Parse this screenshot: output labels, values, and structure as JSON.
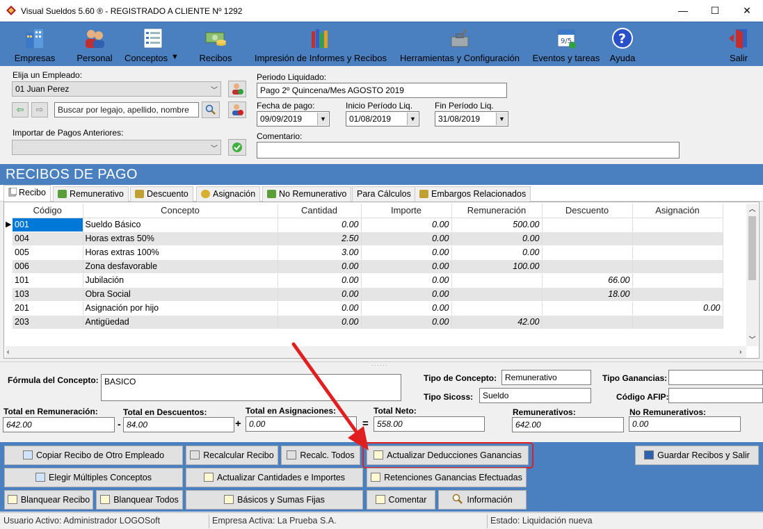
{
  "window": {
    "title": "Visual Sueldos 5.60 ®    - REGISTRADO A CLIENTE Nº 1292",
    "minimize": "—",
    "maximize": "☐",
    "close": "✕"
  },
  "toolbar": {
    "items": [
      {
        "label": "Empresas",
        "icon": "buildings-icon"
      },
      {
        "label": "Personal",
        "icon": "people-icon"
      },
      {
        "label": "Conceptos",
        "icon": "list-icon"
      },
      {
        "label": "Recibos",
        "icon": "money-icon"
      },
      {
        "label": "Impresión de Informes y Recibos",
        "icon": "books-icon"
      },
      {
        "label": "Herramientas y Configuración",
        "icon": "tools-icon"
      },
      {
        "label": "Eventos y tareas",
        "icon": "calendar-icon"
      },
      {
        "label": "Ayuda",
        "icon": "help-icon"
      },
      {
        "label": "Salir",
        "icon": "exit-door-icon"
      }
    ],
    "dropdown_arrow": "▼"
  },
  "form": {
    "employee_label": "Elija un Empleado:",
    "employee_value": "01 Juan Perez",
    "search_placeholder": "Buscar por legajo, apellido, nombre",
    "import_label": "Importar de Pagos Anteriores:",
    "import_value": "",
    "period_label": "Periodo Liquidado:",
    "period_value": "Pago 2º Quincena/Mes AGOSTO 2019",
    "pay_date_label": "Fecha de pago:",
    "pay_date_value": "09/09/2019",
    "start_label": "Inicio Período Liq.",
    "start_value": "01/08/2019",
    "end_label": "Fin Período Liq.",
    "end_value": "31/08/2019",
    "comment_label": "Comentario:",
    "comment_value": ""
  },
  "section_title": "RECIBOS DE PAGO",
  "tabs": [
    {
      "label": "Recibo",
      "color": "#ffffff"
    },
    {
      "label": "Remunerativo",
      "color": "#5a9e3a"
    },
    {
      "label": "Descuento",
      "color": "#c0a030"
    },
    {
      "label": "Asignación",
      "color": "#d8b030"
    },
    {
      "label": "No Remunerativo",
      "color": "#5a9e3a"
    },
    {
      "label": "Para Cálculos",
      "color": ""
    },
    {
      "label": "Embargos Relacionados",
      "color": "#c0a030"
    }
  ],
  "grid": {
    "columns": [
      "Código",
      "Concepto",
      "Cantidad",
      "Importe",
      "Remuneración",
      "Descuento",
      "Asignación"
    ],
    "rows": [
      [
        "001",
        "Sueldo Básico",
        "0.00",
        "0.00",
        "500.00",
        "",
        ""
      ],
      [
        "004",
        "Horas extras 50%",
        "2.50",
        "0.00",
        "0.00",
        "",
        ""
      ],
      [
        "005",
        "Horas extras 100%",
        "3.00",
        "0.00",
        "0.00",
        "",
        ""
      ],
      [
        "006",
        "Zona desfavorable",
        "0.00",
        "0.00",
        "100.00",
        "",
        ""
      ],
      [
        "101",
        "Jubilación",
        "0.00",
        "0.00",
        "",
        "66.00",
        ""
      ],
      [
        "103",
        "Obra Social",
        "0.00",
        "0.00",
        "",
        "18.00",
        ""
      ],
      [
        "201",
        "Asignación por hijo",
        "0.00",
        "0.00",
        "",
        "",
        "0.00"
      ],
      [
        "203",
        "Antigüedad",
        "0.00",
        "0.00",
        "42.00",
        "",
        ""
      ]
    ]
  },
  "details": {
    "formula_label": "Fórmula del Concepto:",
    "formula_value": "BASICO",
    "tipo_concepto_label": "Tipo de Concepto:",
    "tipo_concepto_value": "Remunerativo",
    "tipo_ganancias_label": "Tipo Ganancias:",
    "tipo_ganancias_value": "",
    "tipo_sicoss_label": "Tipo Sicoss:",
    "tipo_sicoss_value": "Sueldo",
    "codigo_afip_label": "Código AFIP:",
    "codigo_afip_value": ""
  },
  "totals": {
    "remuneracion_label": "Total en Remuneración:",
    "remuneracion_value": "642.00",
    "descuentos_label": "Total en Descuentos:",
    "descuentos_value": "84.00",
    "asignaciones_label": "Total en Asignaciones:",
    "asignaciones_value": "0.00",
    "neto_label": "Total Neto:",
    "neto_value": "558.00",
    "remunerativos_label": "Remunerativos:",
    "remunerativos_value": "642.00",
    "no_remunerativos_label": "No Remunerativos:",
    "no_remunerativos_value": "0.00",
    "minus": "-",
    "plus": "+",
    "equals": "="
  },
  "actions": {
    "copiar": "Copiar Recibo de Otro Empleado",
    "recalcular": "Recalcular Recibo",
    "recalc_todos": "Recalc. Todos",
    "actualizar_deducciones": "Actualizar Deducciones Ganancias",
    "guardar": "Guardar Recibos y Salir",
    "elegir": "Elegir Múltiples Conceptos",
    "actualizar_cantidades": "Actualizar Cantidades e Importes",
    "retenciones": "Retenciones  Ganancias Efectuadas",
    "blanquear": "Blanquear Recibo",
    "blanquear_todos": "Blanquear Todos",
    "basicos": "Básicos y Sumas Fijas",
    "comentar": "Comentar",
    "informacion": "Información"
  },
  "status": {
    "usuario": "Usuario Activo: Administrador LOGOSoft",
    "empresa": "Empresa Activa: La Prueba S.A.",
    "estado": "Estado: Liquidación nueva"
  },
  "annotation": {
    "color": "#e02020"
  }
}
